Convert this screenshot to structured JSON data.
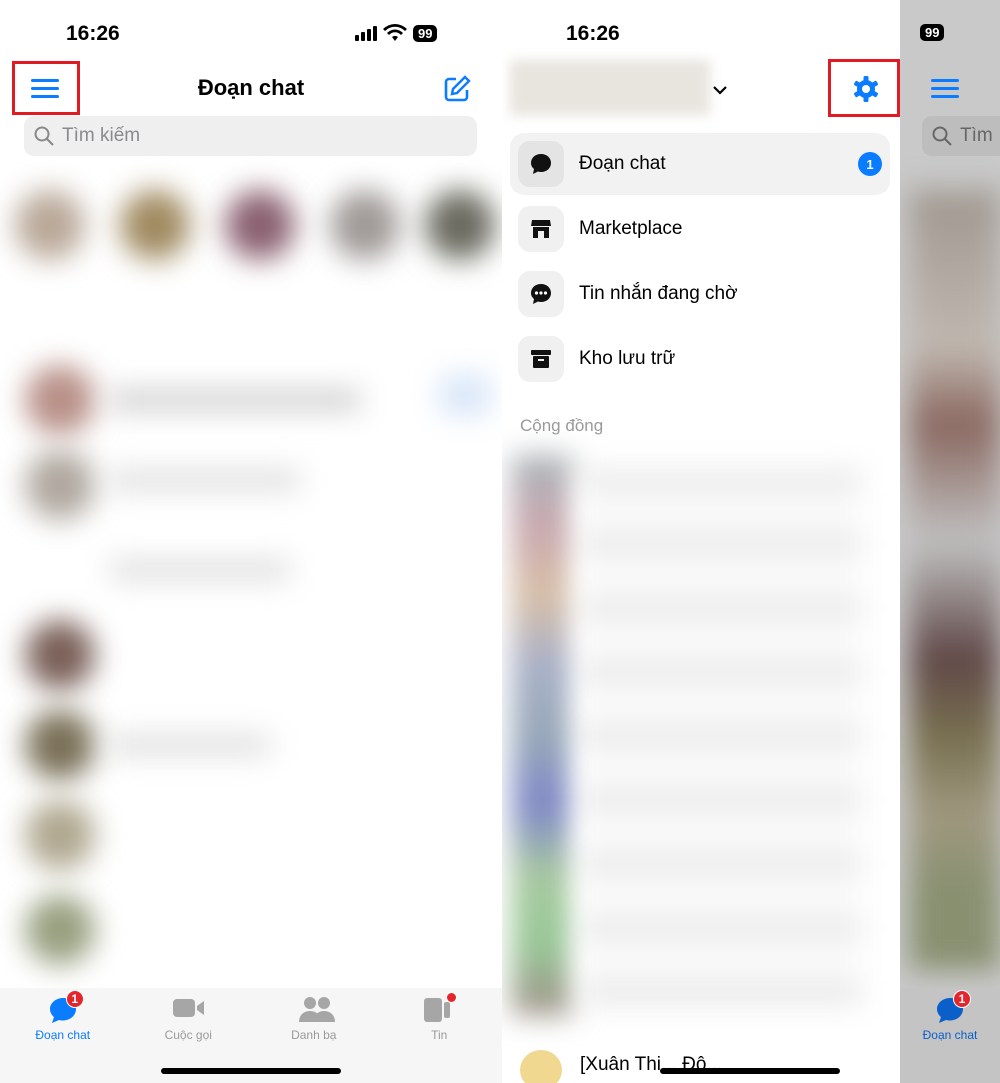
{
  "status": {
    "time": "16:26",
    "battery": "99"
  },
  "left": {
    "title": "Đoạn chat",
    "search_placeholder": "Tìm kiếm",
    "tabs": [
      {
        "label": "Đoạn chat",
        "badge": "1",
        "active": true
      },
      {
        "label": "Cuộc gọi"
      },
      {
        "label": "Danh bạ"
      },
      {
        "label": "Tin",
        "dot": true
      }
    ]
  },
  "drawer": {
    "items": [
      {
        "label": "Đoạn chat",
        "badge": "1",
        "icon": "chat-bubble-icon"
      },
      {
        "label": "Marketplace",
        "icon": "store-icon"
      },
      {
        "label": "Tin nhắn đang chờ",
        "icon": "pending-message-icon"
      },
      {
        "label": "Kho lưu trữ",
        "icon": "archive-icon"
      }
    ],
    "section_title": "Cộng đồng",
    "last_item": "[Xuân Thi... Độ..."
  },
  "peek": {
    "search_partial": "Tìm",
    "tab_label": "Đoạn chat",
    "tab_badge": "1"
  },
  "colors": {
    "accent": "#0a7cff",
    "highlight": "#e21b23",
    "badge": "#e4262c"
  }
}
